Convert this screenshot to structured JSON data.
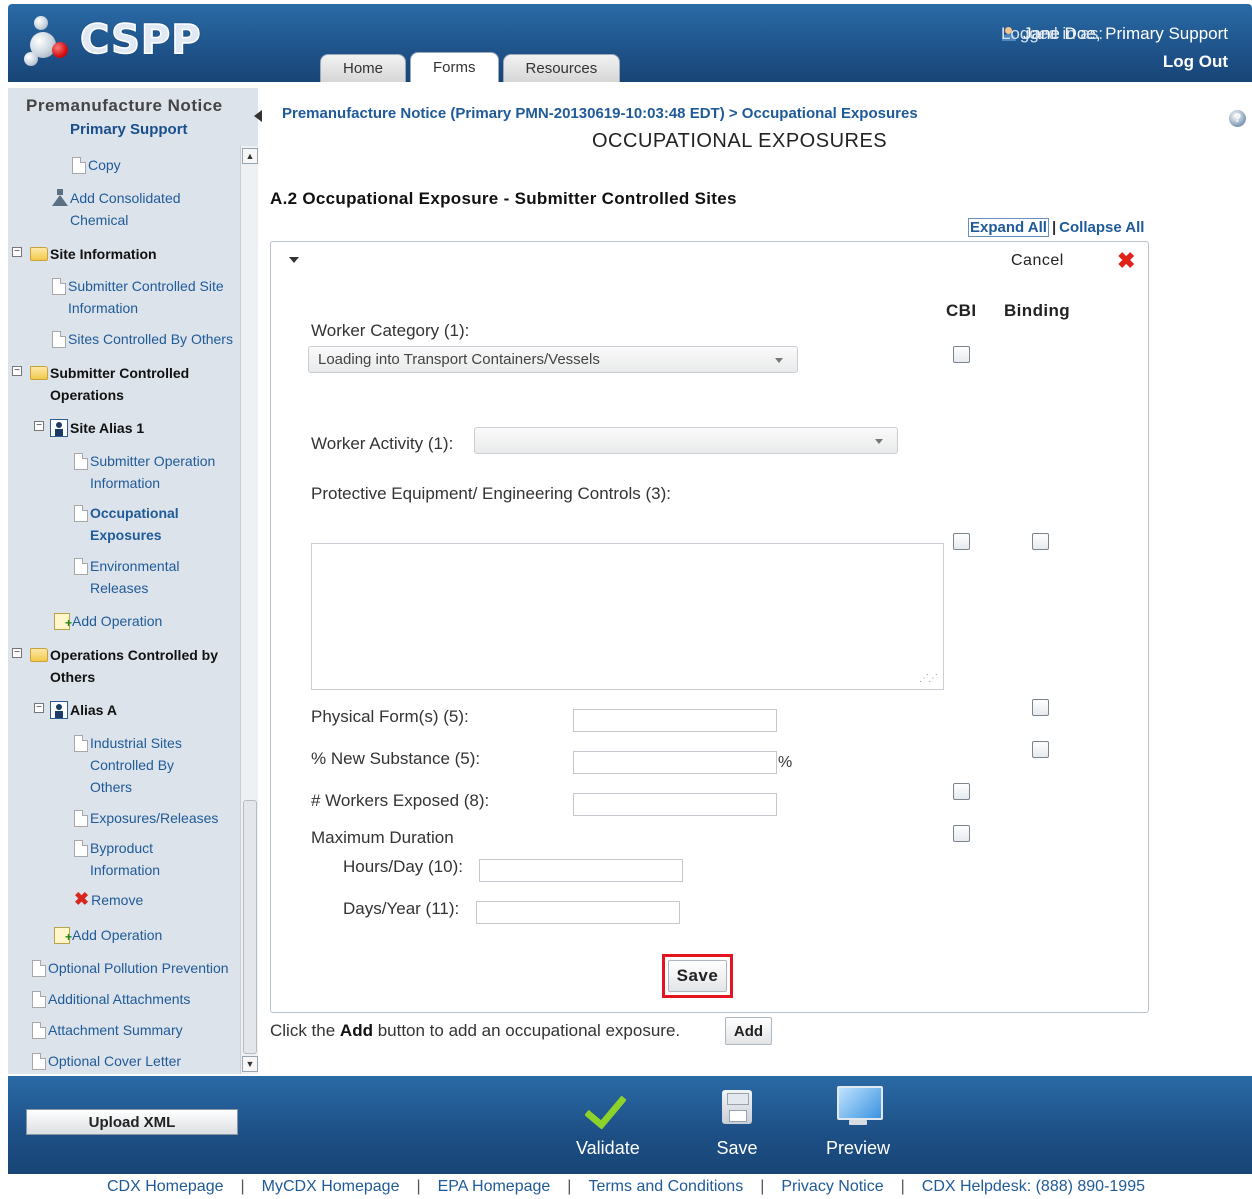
{
  "header": {
    "logo_text": "CSPP",
    "tabs": [
      {
        "label": "Home",
        "active": false
      },
      {
        "label": "Forms",
        "active": true
      },
      {
        "label": "Resources",
        "active": false
      }
    ],
    "logged_in_label": "Logged in as:",
    "logged_in_user": "Jane Doe, Primary Support",
    "logout_label": "Log Out"
  },
  "sidebar": {
    "title": "Premanufacture Notice",
    "subtitle": "Primary Support",
    "items": [
      {
        "label": "Copy",
        "icon": "file-icon"
      },
      {
        "label": "Add Consolidated\nChemical",
        "icon": "flask-icon"
      },
      {
        "label": "Site Information",
        "icon": "folder-icon"
      },
      {
        "label": "Submitter Controlled Site\nInformation",
        "icon": "file-icon"
      },
      {
        "label": "Sites Controlled By Others",
        "icon": "file-icon"
      },
      {
        "label": "Submitter Controlled\nOperations",
        "icon": "folder-icon"
      },
      {
        "label": "Site Alias 1",
        "icon": "site-icon"
      },
      {
        "label": "Submitter Operation\nInformation",
        "icon": "file-icon"
      },
      {
        "label": "Occupational\nExposures",
        "icon": "file-icon"
      },
      {
        "label": "Environmental\nReleases",
        "icon": "file-icon"
      },
      {
        "label": "Add Operation",
        "icon": "add-file-icon"
      },
      {
        "label": "Operations Controlled by\nOthers",
        "icon": "folder-icon"
      },
      {
        "label": "Alias A",
        "icon": "site-icon"
      },
      {
        "label": "Industrial Sites\nControlled By\nOthers",
        "icon": "file-icon"
      },
      {
        "label": "Exposures/Releases",
        "icon": "file-icon"
      },
      {
        "label": "Byproduct\nInformation",
        "icon": "file-icon"
      },
      {
        "label": "Remove",
        "icon": "remove-icon"
      },
      {
        "label": "Add Operation",
        "icon": "add-file-icon"
      },
      {
        "label": "Optional Pollution Prevention",
        "icon": "file-icon"
      },
      {
        "label": "Additional Attachments",
        "icon": "file-icon"
      },
      {
        "label": "Attachment Summary",
        "icon": "file-icon"
      },
      {
        "label": "Optional Cover Letter",
        "icon": "file-icon"
      }
    ]
  },
  "main": {
    "breadcrumb": "Premanufacture Notice (Primary PMN-20130619-10:03:48 EDT) > Occupational Exposures",
    "page_title": "OCCUPATIONAL EXPOSURES",
    "section_title": "A.2 Occupational Exposure - Submitter Controlled Sites",
    "expand_all": "Expand All",
    "collapse_all": "Collapse All",
    "separator": "|",
    "panel": {
      "cancel_label": "Cancel",
      "col_cbi": "CBI",
      "col_binding": "Binding",
      "worker_category_label": "Worker Category (1):",
      "worker_category_value": "Loading into Transport Containers/Vessels",
      "worker_activity_label": "Worker Activity (1):",
      "worker_activity_value": "",
      "protective_label": "Protective Equipment/ Engineering Controls (3):",
      "protective_value": "",
      "physical_form_label": "Physical Form(s) (5):",
      "physical_form_value": "",
      "pct_new_label": "% New Substance (5):",
      "pct_new_value": "",
      "pct_unit": "%",
      "workers_exposed_label": "# Workers Exposed (8):",
      "workers_exposed_value": "",
      "max_duration_label": "Maximum Duration",
      "hours_label": "Hours/Day (10):",
      "hours_value": "",
      "days_label": "Days/Year (11):",
      "days_value": "",
      "save_label": "Save"
    },
    "add_text_pre": "Click the ",
    "add_text_bold": "Add",
    "add_text_post": " button to add an occupational exposure.",
    "add_button": "Add"
  },
  "toolbar": {
    "upload_label": "Upload XML",
    "validate_label": "Validate",
    "save_label": "Save",
    "preview_label": "Preview"
  },
  "footer": {
    "links": [
      "CDX Homepage",
      "MyCDX Homepage",
      "EPA Homepage",
      "Terms and Conditions",
      "Privacy Notice",
      "CDX Helpdesk: (888) 890-1995"
    ],
    "separator": "|"
  },
  "colors": {
    "header_blue": "#1d4f85",
    "link_blue": "#1f5a99",
    "highlight_red": "#e1141f",
    "check_green": "#8dd22a"
  }
}
